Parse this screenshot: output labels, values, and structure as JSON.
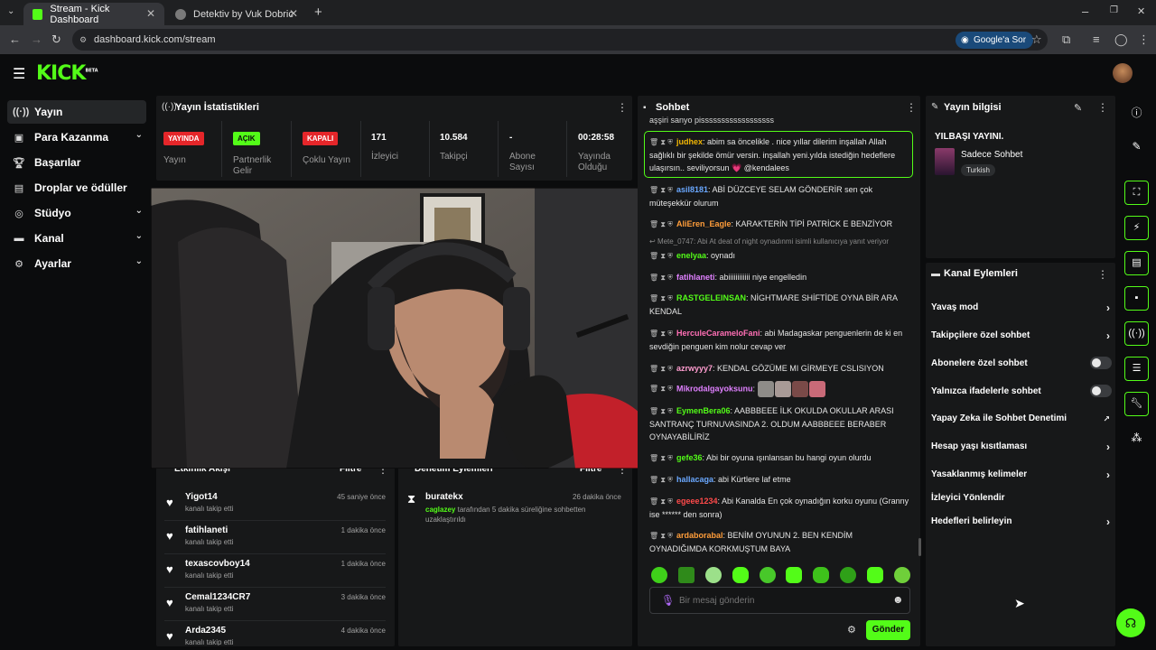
{
  "browser": {
    "tabs": [
      {
        "title": "Stream - Kick Dashboard",
        "active": true
      },
      {
        "title": "Detektiv by Vuk Dobric",
        "active": false
      }
    ],
    "url": "dashboard.kick.com/stream",
    "google_button": "Google'a Sor"
  },
  "app": {
    "logo_text": "KICK",
    "logo_badge": "BETA",
    "brand_color": "#53fc18"
  },
  "sidebar": {
    "items": [
      {
        "label": "Yayın",
        "icon": "broadcast-icon",
        "active": true,
        "chevron": false
      },
      {
        "label": "Para Kazanma",
        "icon": "wallet-icon",
        "active": false,
        "chevron": true
      },
      {
        "label": "Başarılar",
        "icon": "trophy-icon",
        "active": false,
        "chevron": false
      },
      {
        "label": "Droplar ve ödüller",
        "icon": "gift-icon",
        "active": false,
        "chevron": false
      },
      {
        "label": "Stüdyo",
        "icon": "studio-icon",
        "active": false,
        "chevron": true
      },
      {
        "label": "Kanal",
        "icon": "channel-icon",
        "active": false,
        "chevron": true
      },
      {
        "label": "Ayarlar",
        "icon": "gear-icon",
        "active": false,
        "chevron": true
      }
    ]
  },
  "stats": {
    "title": "Yayın İstatistikleri",
    "live_badge": "YAYINDA",
    "live_label": "Yayın",
    "partner_badge": "AÇIK",
    "partner_label": "Partnerlik Gelir",
    "multi_badge": "KAPALI",
    "multi_label": "Çoklu Yayın",
    "viewers_value": "171",
    "viewers_label": "İzleyici",
    "followers_value": "10.584",
    "followers_label": "Takipçi",
    "subs_value": "-",
    "subs_label": "Abone Sayısı",
    "uptime_value": "00:28:58",
    "uptime_label": "Yayında Olduğu"
  },
  "activity": {
    "title": "Etkinlik Akışı",
    "filter": "Filtre",
    "events": [
      {
        "name": "Yigot14",
        "sub": "kanalı takip etti",
        "time": "45 saniye önce"
      },
      {
        "name": "fatihlaneti",
        "sub": "kanalı takip etti",
        "time": "1 dakika önce"
      },
      {
        "name": "texascovboy14",
        "sub": "kanalı takip etti",
        "time": "1 dakika önce"
      },
      {
        "name": "Cemal1234CR7",
        "sub": "kanalı takip etti",
        "time": "3 dakika önce"
      },
      {
        "name": "Arda2345",
        "sub": "kanalı takip etti",
        "time": "4 dakika önce"
      }
    ]
  },
  "moderation": {
    "title": "Denetim Eylemleri",
    "filter": "Filtre",
    "entry_user": "buratekx",
    "entry_time": "26 dakika önce",
    "entry_actor": "caglazey",
    "entry_text": "tarafından 5 dakika süreliğine sohbetten uzaklaştırıldı"
  },
  "chat": {
    "title": "Sohbet",
    "partial_top": "aşşiri sanyo pissssssssssssssssss",
    "messages": [
      {
        "user": "judhex",
        "color": "#f2b705",
        "text": "abim sa öncelikle . nice yıllar dilerim inşallah Allah sağlıklı bir şekilde ömür versin. inşallah yeni.yılda istediğin hedeflere ulaşırsın.. seviliyorsun 💗 @kendalees",
        "highlight": true
      },
      {
        "user": "asil8181",
        "color": "#6aa8ff",
        "text": "ABİ DÜZCEYE SELAM GÖNDERİR sen çok müteşekkür olurum"
      },
      {
        "user": "AliEren_Eagle",
        "color": "#ff9d3a",
        "text": "KARAKTERİN TİPİ PATRİCK E BENZİYOR"
      },
      {
        "user": "enelyaa",
        "color": "#53fc18",
        "text": "oynadı"
      },
      {
        "user": "fatihlaneti",
        "color": "#e080ff",
        "text": "abiiiiiiiiiiii niye engelledin"
      },
      {
        "user": "RASTGELEINSAN",
        "color": "#53fc18",
        "text": "NİGHTMARE SHİFTİDE OYNA BİR ARA KENDAL"
      },
      {
        "user": "HerculeCarameloFani",
        "color": "#ff6fb5",
        "text": "abi Madagaskar penguenlerin de ki en sevdiğin penguen kim nolur cevap ver"
      },
      {
        "user": "azrwyyy7",
        "color": "#ff9dd0",
        "text": "KENDAL GÖZÜME MI GİRMEYE CSLISIYON"
      },
      {
        "user": "Mikrodalgayoksunu",
        "color": "#e080ff",
        "text": ""
      },
      {
        "user": "EymenBera06",
        "color": "#53fc18",
        "text": "AABBBEEE İLK OKULDA OKULLAR ARASI SANTRANÇ TURNUVASINDA 2. OLDUM AABBBEEE BERABER OYNAYABİLİRİZ"
      },
      {
        "user": "gefe36",
        "color": "#53fc18",
        "text": "Abi bir oyuna ışınlansan bu hangi oyun olurdu"
      },
      {
        "user": "hallacaga",
        "color": "#6aa8ff",
        "text": "abi Kürtlere laf etme"
      },
      {
        "user": "egeee1234",
        "color": "#ff4a4a",
        "text": "Abi Kanalda En çok oynadığın korku oyunu (Granny ise ****** den sonra)"
      },
      {
        "user": "ardaborabal",
        "color": "#ff9d3a",
        "text": "BENİM OYUNUN 2. BEN KENDİM OYNADIĞIMDA KORKMUŞTUM BAYA"
      }
    ],
    "reply_note": "Mete_0747: Abi At deat of night oynadınmi isimli kullanıcıya yanıt veriyor",
    "input_placeholder": "Bir mesaj gönderin",
    "send_label": "Gönder"
  },
  "stream_info": {
    "title": "Yayın bilgisi",
    "stream_title": "YILBAŞI YAYINI.",
    "category": "Sadece Sohbet",
    "language_tag": "Turkish"
  },
  "channel_actions": {
    "title": "Kanal Eylemleri",
    "items": [
      {
        "label": "Yavaş mod",
        "kind": "chevron"
      },
      {
        "label": "Takipçilere özel sohbet",
        "kind": "chevron"
      },
      {
        "label": "Abonelere özel sohbet",
        "kind": "toggle",
        "on": false
      },
      {
        "label": "Yalnızca ifadelerle sohbet",
        "kind": "toggle",
        "on": false
      },
      {
        "label": "Yapay Zeka ile Sohbet Denetimi",
        "kind": "external"
      },
      {
        "label": "Hesap yaşı kısıtlaması",
        "kind": "chevron"
      },
      {
        "label": "Yasaklanmış kelimeler",
        "kind": "chevron"
      },
      {
        "label": "İzleyici Yönlendir",
        "kind": "none"
      },
      {
        "label": "Hedefleri belirleyin",
        "kind": "chevron"
      }
    ]
  }
}
